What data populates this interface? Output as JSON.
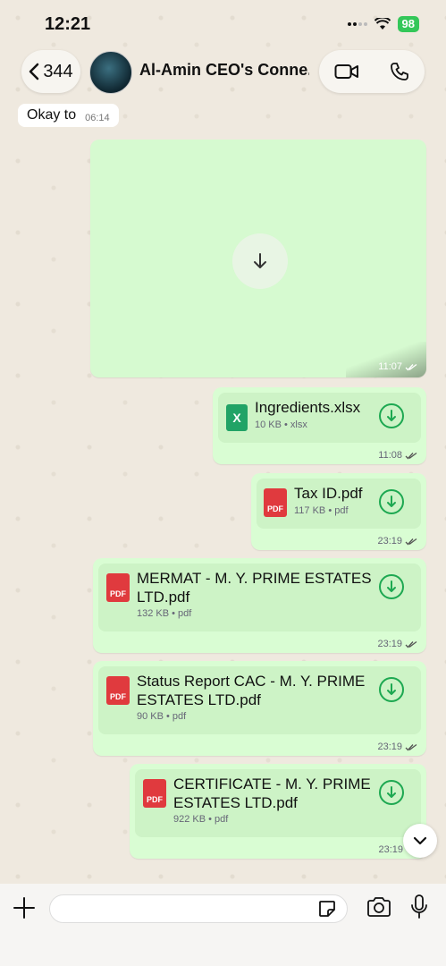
{
  "status_bar": {
    "time": "12:21",
    "battery": "98"
  },
  "header": {
    "back_count": "344",
    "title": "Al-Amin CEO's Conne..."
  },
  "incoming": {
    "text": "Okay to",
    "time": "06:14"
  },
  "media_message": {
    "time": "11:07"
  },
  "documents": [
    {
      "name": "Ingredients.xlsx",
      "meta": "10 KB • xlsx",
      "time": "11:08",
      "type": "xlsx"
    },
    {
      "name": "Tax ID.pdf",
      "meta": "117 KB • pdf",
      "time": "23:19",
      "type": "pdf"
    },
    {
      "name_line1": "MERMAT - M. Y. PRIME ESTATES",
      "name_line2": "LTD.pdf",
      "meta": "132 KB • pdf",
      "time": "23:19",
      "type": "pdf"
    },
    {
      "name_line1": "Status Report CAC - M. Y. PRIME",
      "name_line2": "ESTATES LTD.pdf",
      "meta": "90 KB • pdf",
      "time": "23:19",
      "type": "pdf"
    },
    {
      "name_line1": "CERTIFICATE - M. Y. PRIME",
      "name_line2": "ESTATES LTD.pdf",
      "meta": "922 KB • pdf",
      "time": "23:19",
      "type": "pdf"
    }
  ],
  "icons": {
    "pdf_label": "PDF",
    "xls_label": "X"
  },
  "colors": {
    "bubble": "#d9fdd3",
    "accent": "#1da851",
    "pdf": "#e03a3e",
    "xlsx": "#21a366"
  }
}
